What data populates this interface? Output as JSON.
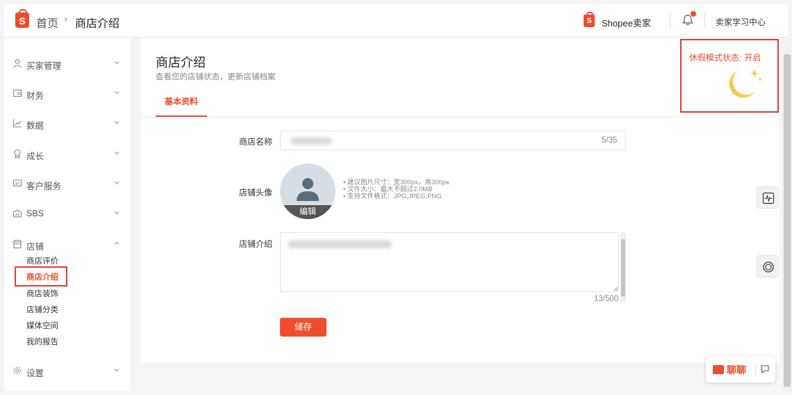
{
  "header": {
    "logo_letter": "S",
    "breadcrumb_home": "首页",
    "breadcrumb_sep": "›",
    "breadcrumb_current": "商店介绍",
    "seller_logo_letter": "S",
    "seller_brand": "Shopee卖家",
    "learning_center": "卖家学习中心"
  },
  "sidebar": {
    "items": [
      {
        "label": "买家管理",
        "icon": "user-icon"
      },
      {
        "label": "财务",
        "icon": "wallet-icon"
      },
      {
        "label": "数据",
        "icon": "chart-icon"
      },
      {
        "label": "成长",
        "icon": "badge-icon"
      },
      {
        "label": "客户服务",
        "icon": "message-icon"
      },
      {
        "label": "SBS",
        "icon": "box-icon"
      },
      {
        "label": "店铺",
        "icon": "store-icon",
        "expanded": true
      },
      {
        "label": "设置",
        "icon": "gear-icon"
      }
    ],
    "store_sub_items": [
      "商店评价",
      "商店介绍",
      "商店装饰",
      "店铺分类",
      "媒体空间",
      "我的报告"
    ],
    "active_sub_item": "商店介绍"
  },
  "main": {
    "title": "商店介绍",
    "subtitle": "查看您的店铺状态，更新店铺档案",
    "tab": "基本资料",
    "vacation_label": "休假模式状态:",
    "vacation_value": "开启",
    "fields": {
      "name_label": "商店名称",
      "name_count": "5/35",
      "avatar_label": "店铺头像",
      "avatar_edit": "编辑",
      "avatar_tips": [
        "• 建议图片尺寸：宽300px，高300px",
        "• 文件大小：最大不超过2.0MB",
        "• 支持文件格式：JPG,JPEG,PNG"
      ],
      "intro_label": "店铺介绍",
      "intro_count": "13/500"
    },
    "save_button": "储存"
  },
  "chat": {
    "label": "聊聊"
  },
  "colors": {
    "brand": "#ee4d2d",
    "highlight_box": "#e03c2c"
  }
}
